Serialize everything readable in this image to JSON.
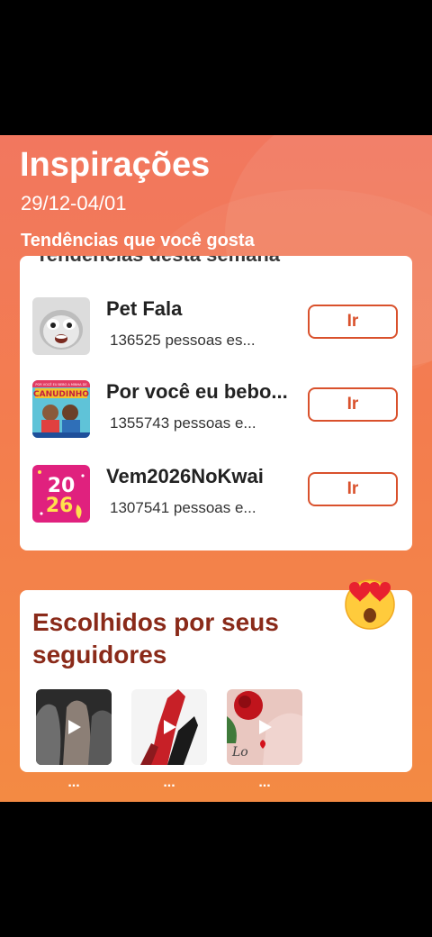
{
  "header": {
    "title": "Inspirações",
    "date_range": "29/12-04/01",
    "subtitle": "Tendências que você gosta"
  },
  "trending": {
    "cut_off_heading": "Tendências desta semana",
    "items": [
      {
        "name": "Pet Fala",
        "count": "136525 pessoas es...",
        "button": "Ir",
        "icon": "cat-face-thumbnail"
      },
      {
        "name": "Por você eu bebo...",
        "count": "1355743 pessoas e...",
        "button": "Ir",
        "icon": "canudinho-music-thumbnail"
      },
      {
        "name": "Vem2026NoKwai",
        "count": "1307541 pessoas e...",
        "button": "Ir",
        "icon": "2026-thumbnail"
      }
    ]
  },
  "followers": {
    "title": "Escolhidos por seus seguidores",
    "emoji": "heart-eyes-emoji",
    "videos": [
      {
        "label": "...",
        "icon": "play-icon"
      },
      {
        "label": "...",
        "icon": "play-icon"
      },
      {
        "label": "...",
        "icon": "play-icon"
      }
    ]
  },
  "thumb_texts": {
    "canudinho_top": "POR VOCÊ EU BEBO A MINHA DE",
    "canudinho": "CANUDINHO",
    "year_top": "20",
    "year_bottom": "26",
    "love": "Lo"
  },
  "colors": {
    "accent": "#d9512c",
    "title_dark_red": "#8a2a19",
    "gradient_top": "#f2775f",
    "gradient_bottom": "#f38a43"
  }
}
